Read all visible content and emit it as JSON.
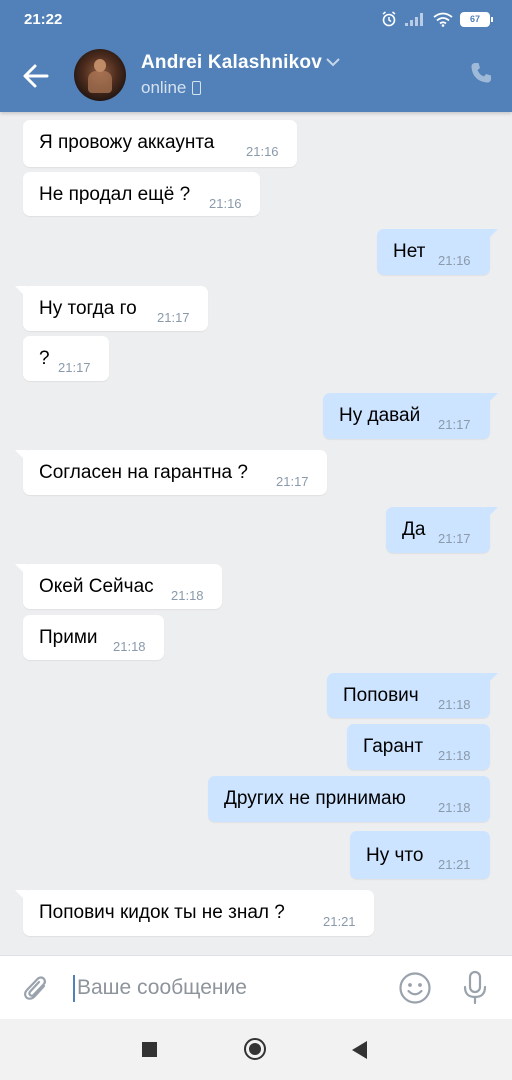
{
  "status_bar": {
    "time": "21:22",
    "battery": "67"
  },
  "header": {
    "name": "Andrei Kalashnikov",
    "status": "online"
  },
  "messages": [
    {
      "dir": "in",
      "text": "Я провожу аккаунта",
      "time": "21:16"
    },
    {
      "dir": "in",
      "text": "Не продал ещё ?",
      "time": "21:16"
    },
    {
      "dir": "out",
      "text": "Нет",
      "time": "21:16"
    },
    {
      "dir": "in",
      "text": "Ну тогда го",
      "time": "21:17"
    },
    {
      "dir": "in",
      "text": "?",
      "time": "21:17"
    },
    {
      "dir": "out",
      "text": "Ну давай",
      "time": "21:17"
    },
    {
      "dir": "in",
      "text": "Согласен на гарантна ?",
      "time": "21:17"
    },
    {
      "dir": "out",
      "text": "Да",
      "time": "21:17"
    },
    {
      "dir": "in",
      "text": "Окей Сейчас",
      "time": "21:18"
    },
    {
      "dir": "in",
      "text": "Прими",
      "time": "21:18"
    },
    {
      "dir": "out",
      "text": "Попович",
      "time": "21:18"
    },
    {
      "dir": "out",
      "text": "Гарант",
      "time": "21:18"
    },
    {
      "dir": "out",
      "text": "Других не принимаю",
      "time": "21:18"
    },
    {
      "dir": "out",
      "text": "Ну что",
      "time": "21:21"
    },
    {
      "dir": "in",
      "text": "Попович кидок ты не знал ?",
      "time": "21:21"
    }
  ],
  "composer": {
    "placeholder": "Ваше сообщение"
  },
  "colors": {
    "header": "#5181b8",
    "incoming": "#ffffff",
    "outgoing": "#cce4ff",
    "background": "#edeef0"
  }
}
